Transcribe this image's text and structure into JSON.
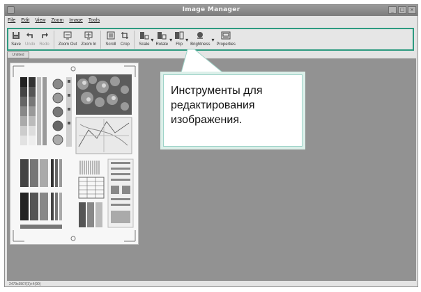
{
  "window": {
    "title": "Image Manager",
    "controls": [
      "_",
      "□",
      "×"
    ]
  },
  "menu": {
    "items": [
      "File",
      "Edit",
      "View",
      "Zoom",
      "Image",
      "Tools"
    ]
  },
  "toolbar": {
    "tools": [
      {
        "label": "Save",
        "icon": "save-icon",
        "enabled": true
      },
      {
        "label": "Undo",
        "icon": "undo-icon",
        "enabled": false
      },
      {
        "label": "Redo",
        "icon": "redo-icon",
        "enabled": false
      },
      {
        "label": "Zoom Out",
        "icon": "zoom-out-icon",
        "enabled": true
      },
      {
        "label": "Zoom In",
        "icon": "zoom-in-icon",
        "enabled": true
      },
      {
        "label": "Scroll",
        "icon": "scroll-icon",
        "enabled": true
      },
      {
        "label": "Crop",
        "icon": "crop-icon",
        "enabled": true
      },
      {
        "label": "Scale",
        "icon": "scale-icon",
        "enabled": true
      },
      {
        "label": "Rotate",
        "icon": "rotate-icon",
        "enabled": true
      },
      {
        "label": "Flip",
        "icon": "flip-icon",
        "enabled": true
      },
      {
        "label": "Brightness",
        "icon": "brightness-icon",
        "enabled": true
      },
      {
        "label": "Properties",
        "icon": "properties-icon",
        "enabled": true
      }
    ],
    "highlight_color": "#2d9a80"
  },
  "document": {
    "tab_label": "Untitled"
  },
  "callout": {
    "text": "Инструменты для\nредактирования\nизображения."
  },
  "status": {
    "text": "2479x3507(3)+4(90)"
  }
}
